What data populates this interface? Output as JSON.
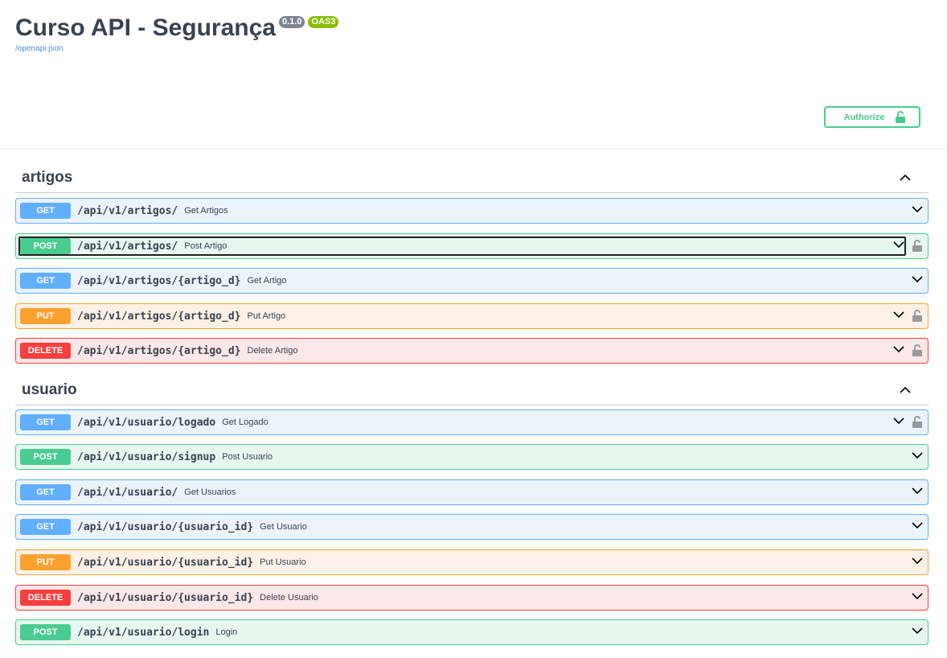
{
  "header": {
    "title": "Curso API - Segurança",
    "version_badge": "0.1.0",
    "oas_badge": "OAS3",
    "spec_link": "/openapi.json",
    "authorize_label": "Authorize"
  },
  "tags": [
    {
      "name": "artigos",
      "operations": [
        {
          "method": "GET",
          "path": "/api/v1/artigos/",
          "summary": "Get Artigos",
          "locked": false
        },
        {
          "method": "POST",
          "path": "/api/v1/artigos/",
          "summary": "Post Artigo",
          "locked": true
        },
        {
          "method": "GET",
          "path": "/api/v1/artigos/{artigo_d}",
          "summary": "Get Artigo",
          "locked": false
        },
        {
          "method": "PUT",
          "path": "/api/v1/artigos/{artigo_d}",
          "summary": "Put Artigo",
          "locked": true
        },
        {
          "method": "DELETE",
          "path": "/api/v1/artigos/{artigo_d}",
          "summary": "Delete Artigo",
          "locked": true
        }
      ]
    },
    {
      "name": "usuario",
      "operations": [
        {
          "method": "GET",
          "path": "/api/v1/usuario/logado",
          "summary": "Get Logado",
          "locked": true
        },
        {
          "method": "POST",
          "path": "/api/v1/usuario/signup",
          "summary": "Post Usuario",
          "locked": false
        },
        {
          "method": "GET",
          "path": "/api/v1/usuario/",
          "summary": "Get Usuarios",
          "locked": false
        },
        {
          "method": "GET",
          "path": "/api/v1/usuario/{usuario_id}",
          "summary": "Get Usuario",
          "locked": false
        },
        {
          "method": "PUT",
          "path": "/api/v1/usuario/{usuario_id}",
          "summary": "Put Usuario",
          "locked": false
        },
        {
          "method": "DELETE",
          "path": "/api/v1/usuario/{usuario_id}",
          "summary": "Delete Usuario",
          "locked": false
        },
        {
          "method": "POST",
          "path": "/api/v1/usuario/login",
          "summary": "Login",
          "locked": false
        }
      ]
    }
  ],
  "colors": {
    "get": "#61affe",
    "post": "#49cc90",
    "put": "#fca130",
    "delete": "#f93e3e"
  }
}
